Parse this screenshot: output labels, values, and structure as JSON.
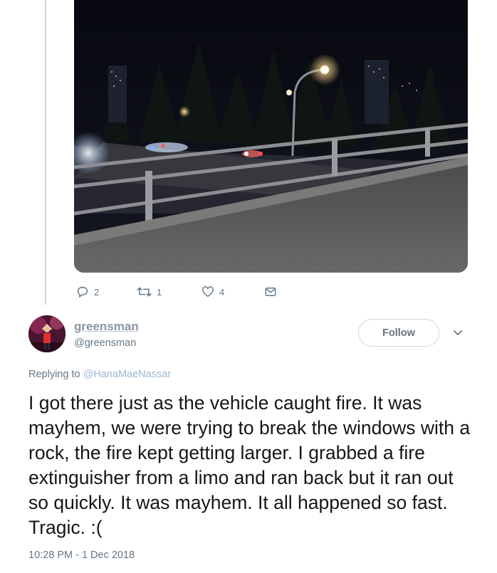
{
  "tweet_actions": {
    "reply_count": "2",
    "retweet_count": "1",
    "like_count": "4"
  },
  "reply": {
    "display_name": "greensman",
    "handle": "@greensman",
    "follow_label": "Follow",
    "replying_prefix": "Replying to",
    "replying_to": "@HanaMaeNassar",
    "text": "I got there just as the vehicle caught fire. It was mayhem, we were trying to break the windows with a rock, the fire kept getting larger. I grabbed a fire extinguisher from a limo and ran back but it ran out so quickly. It was mayhem. It all happened so fast. Tragic. :(",
    "timestamp": "10:28 PM - 1 Dec 2018"
  },
  "icons": {
    "reply": "reply-icon",
    "retweet": "retweet-icon",
    "like": "heart-icon",
    "dm": "envelope-icon",
    "more": "chevron-down-icon"
  },
  "colors": {
    "accent_link": "#9ab7cf",
    "muted_text": "#657786",
    "body_text": "#14171a"
  }
}
